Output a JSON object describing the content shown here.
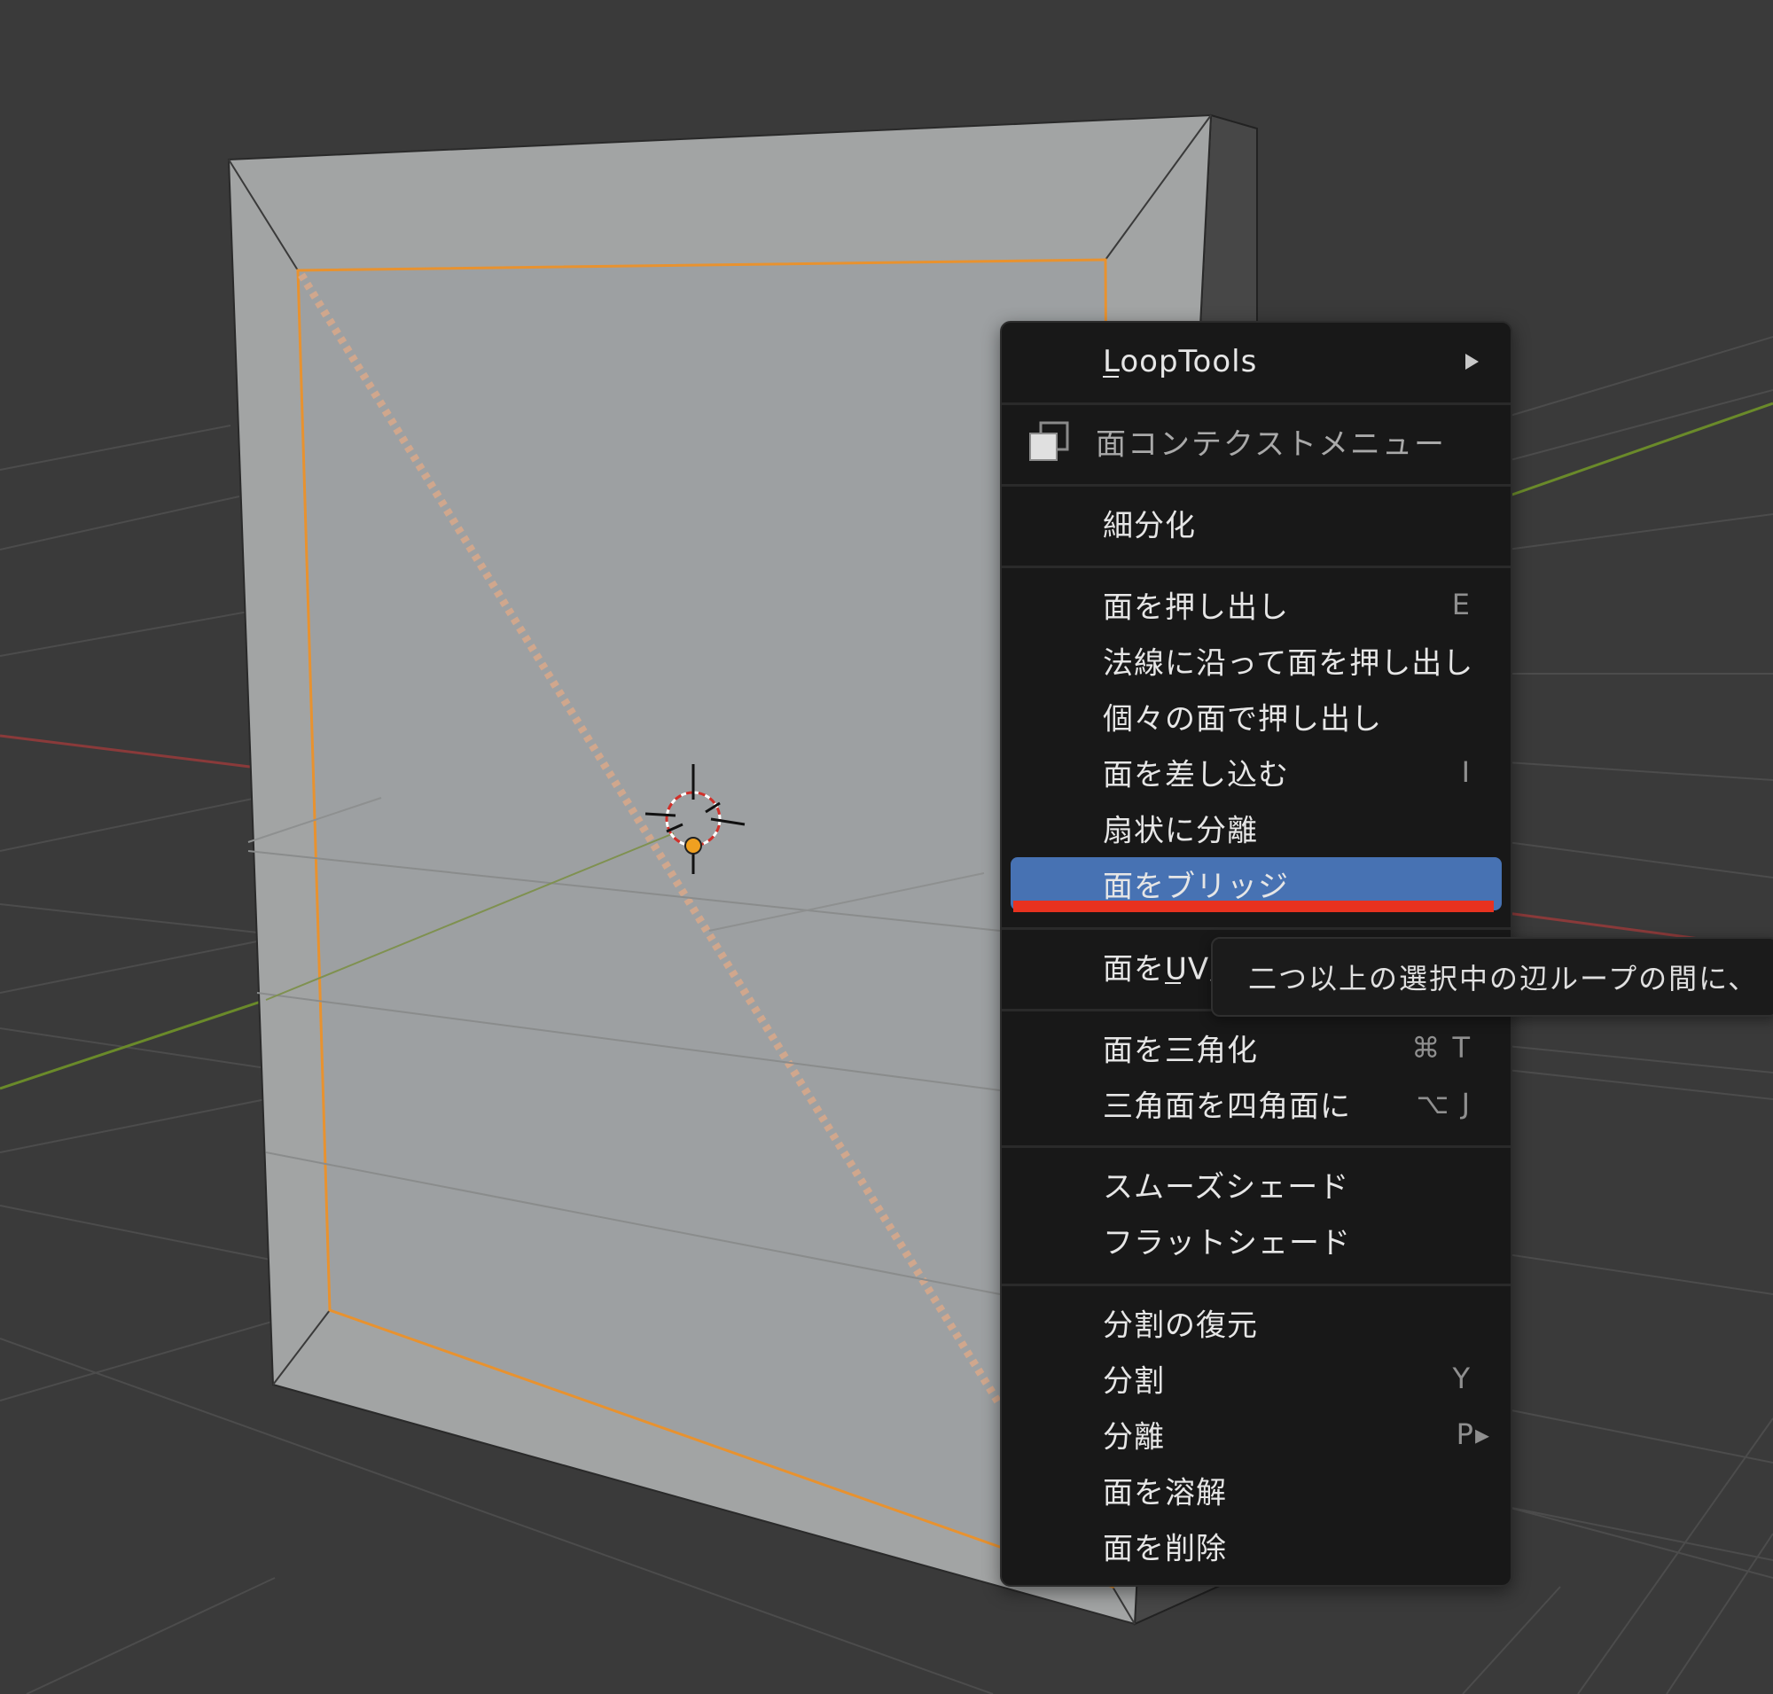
{
  "viewport": {
    "background_color": "#3a3a3a",
    "grid_color": "#4a4a4a",
    "x_axis_color": "#8a3a3a",
    "y_axis_color": "#6a8a2a",
    "mesh_face_color": "#a2a4a4",
    "mesh_side_color": "#474747",
    "selection_color": "#e8922f"
  },
  "context_menu": {
    "top_item": {
      "label": "LoopTools",
      "has_submenu": true
    },
    "header": {
      "label": "面コンテクストメニュー",
      "icon": "face-mode-icon"
    },
    "items": [
      {
        "label": "細分化",
        "shortcut": ""
      },
      {
        "label": "面を押し出し",
        "shortcut": "E"
      },
      {
        "label": "法線に沿って面を押し出し",
        "shortcut": ""
      },
      {
        "label": "個々の面で押し出し",
        "shortcut": ""
      },
      {
        "label": "面を差し込む",
        "shortcut": "I"
      },
      {
        "label": "扇状に分離",
        "shortcut": ""
      },
      {
        "label": "面をブリッジ",
        "shortcut": "",
        "highlighted": true
      },
      {
        "label": "面をUV展開",
        "shortcut": ""
      },
      {
        "label": "面を三角化",
        "shortcut": "⌘ T"
      },
      {
        "label": "三角面を四角面に",
        "shortcut": "⌥ J"
      },
      {
        "label": "スムーズシェード",
        "shortcut": ""
      },
      {
        "label": "フラットシェード",
        "shortcut": ""
      },
      {
        "label": "分割の復元",
        "shortcut": ""
      },
      {
        "label": "分割",
        "shortcut": "Y"
      },
      {
        "label": "分離",
        "shortcut": "P▸"
      },
      {
        "label": "面を溶解",
        "shortcut": ""
      },
      {
        "label": "面を削除",
        "shortcut": ""
      }
    ],
    "highlight_color": "#4772b3",
    "annotation_color": "#e8321f"
  },
  "tooltip": {
    "text": "二つ以上の選択中の辺ループの間に、"
  }
}
